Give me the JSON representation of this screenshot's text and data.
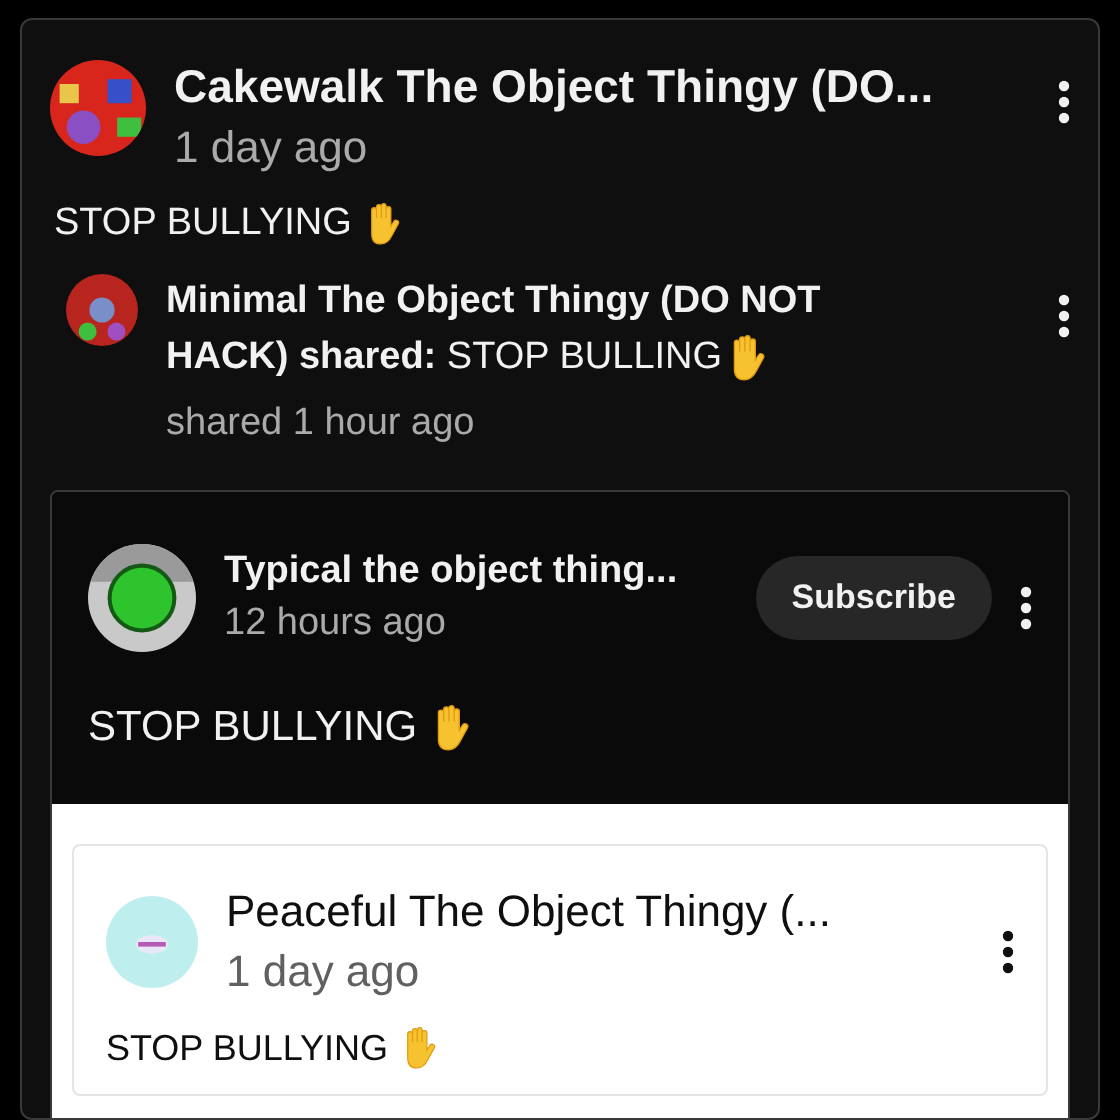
{
  "post": {
    "author": "Cakewalk The Object Thingy (DO...",
    "time": "1 day ago",
    "text": "STOP BULLYING",
    "share": {
      "lines": [
        "**Minimal The Object Thingy (DO NOT**",
        "**HACK) shared:** STOP BULLING"
      ],
      "time": "shared 1 hour ago"
    },
    "embedded": {
      "author": "Typical the object thing...",
      "time": "12 hours ago",
      "subscribe": "Subscribe",
      "text": "STOP BULLYING",
      "quoted": {
        "author": "Peaceful The Object Thingy (...",
        "time": "1 day ago",
        "text": "STOP BULLYING"
      }
    }
  }
}
